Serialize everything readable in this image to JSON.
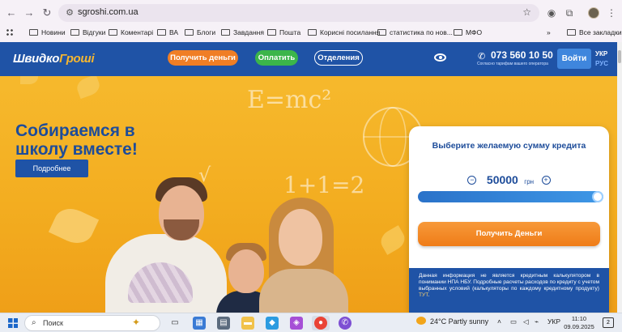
{
  "browser": {
    "url": "sgroshi.com.ua",
    "bookmarks": [
      "Новини",
      "Відгуки",
      "Коментарі",
      "ВА",
      "Блоги",
      "Завдання",
      "Пошта",
      "Корисні посилання",
      "статистика по нов...",
      "МФО"
    ],
    "more_bookmarks": "»",
    "all_bookmarks": "Все закладки"
  },
  "site": {
    "logo_part1": "Швидко",
    "logo_part2": "Гроші",
    "nav": {
      "get_money": "Получить деньги",
      "pay": "Оплатить",
      "branches": "Отделения"
    },
    "phone": "073 560 10 50",
    "phone_note": "Согласно тарифам вашего оператора",
    "login": "Войти",
    "lang_ukr": "УКР",
    "lang_rus": "РУС"
  },
  "hero": {
    "title_line1": "Собираемся в",
    "title_line2": "школу вместе!",
    "more_button": "Подробнее",
    "board_formula1": "E=mc²",
    "board_formula2": "1+1=2",
    "board_symbol": "√"
  },
  "calculator": {
    "title": "Выберите желаемую сумму кредита",
    "minus": "−",
    "plus": "+",
    "amount": "50000",
    "currency": "грн",
    "slider_fraction": 1.0,
    "submit": "Получить Деньги",
    "disclaimer": "Данная информация не является кредитным калькулятором в понимании НПА НБУ. Подробные расчеты расходов по кредиту с учетом выбранных условий (калькуляторы по каждому кредитному продукту)",
    "disclaimer_link": "ТУТ"
  },
  "taskbar": {
    "search_placeholder": "Поиск",
    "weather": "24°C  Partly sunny",
    "lang": "УКР",
    "time": "11:10",
    "date": "09.09.2025",
    "notifications": "2"
  }
}
